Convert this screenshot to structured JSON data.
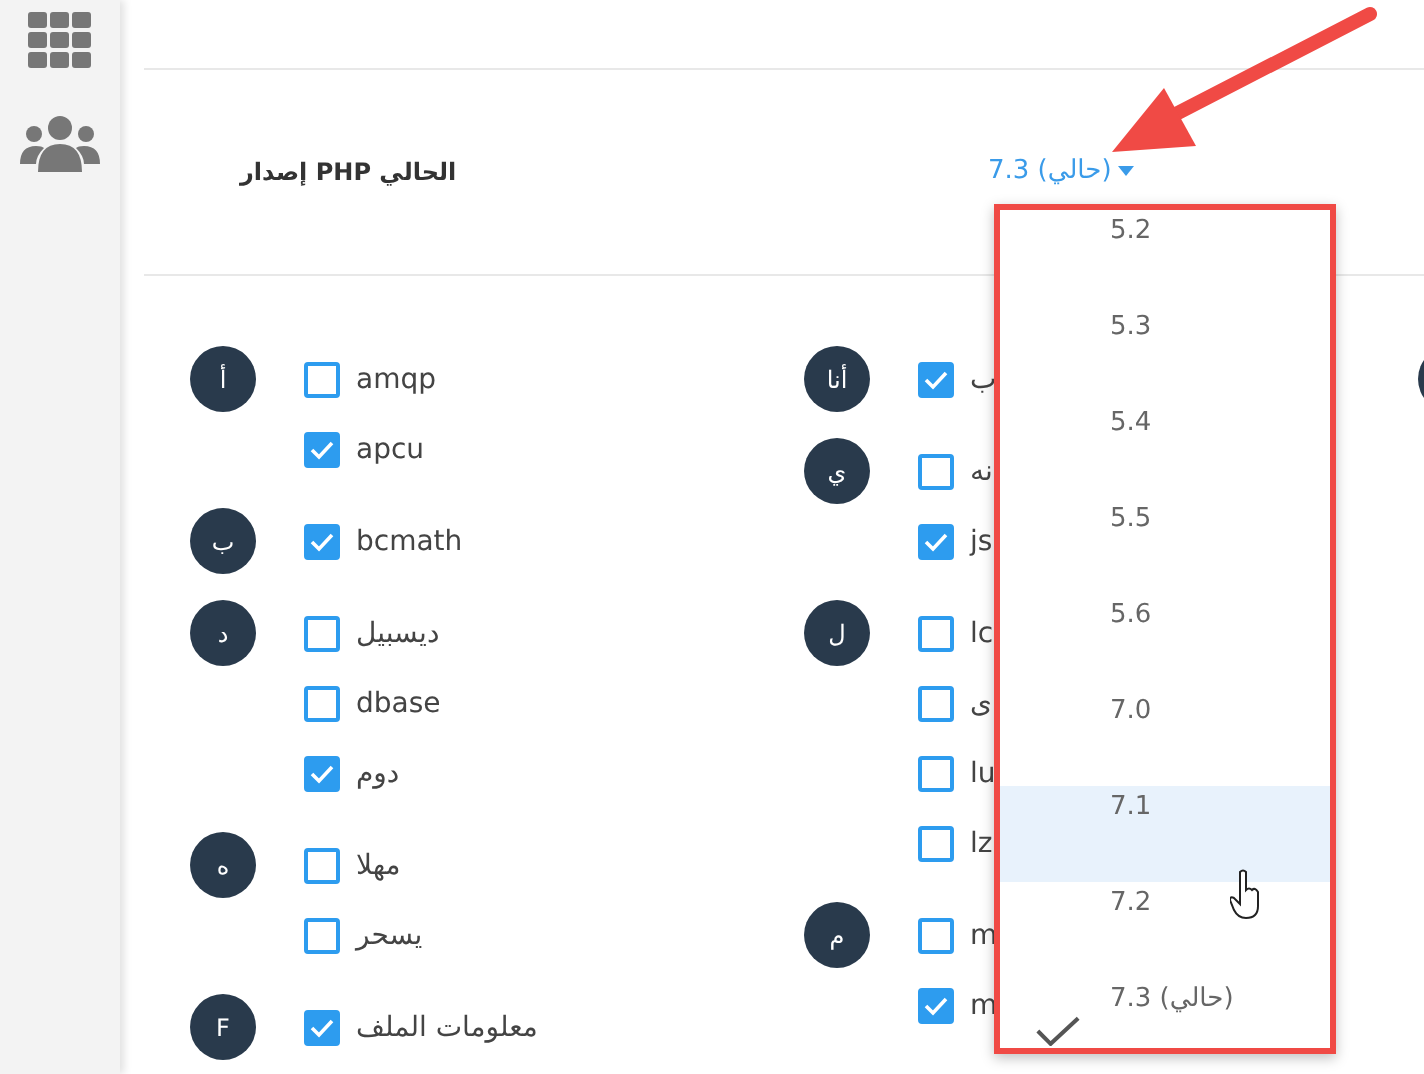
{
  "version_setting": {
    "label": "إصدار PHP الحالي",
    "current": "7.3 (حالي)"
  },
  "version_menu": [
    {
      "label": "5.2",
      "selected": false,
      "hovered": false
    },
    {
      "label": "5.3",
      "selected": false,
      "hovered": false
    },
    {
      "label": "5.4",
      "selected": false,
      "hovered": false
    },
    {
      "label": "5.5",
      "selected": false,
      "hovered": false
    },
    {
      "label": "5.6",
      "selected": false,
      "hovered": false
    },
    {
      "label": "7.0",
      "selected": false,
      "hovered": false
    },
    {
      "label": "7.1",
      "selected": false,
      "hovered": true
    },
    {
      "label": "7.2",
      "selected": false,
      "hovered": false
    },
    {
      "label": "7.3 (حالي)",
      "selected": true,
      "hovered": false
    }
  ],
  "extension_columns": {
    "left_column": [
      {
        "letter": "أ",
        "items": [
          {
            "label": "amqp",
            "checked": false
          },
          {
            "label": "apcu",
            "checked": true
          }
        ]
      },
      {
        "letter": "ب",
        "items": [
          {
            "label": "bcmath",
            "checked": true
          }
        ]
      },
      {
        "letter": "د",
        "items": [
          {
            "label": "ديسبيل",
            "checked": false
          },
          {
            "label": "dbase",
            "checked": false
          },
          {
            "label": "دوم",
            "checked": true
          }
        ]
      },
      {
        "letter": "ه",
        "items": [
          {
            "label": "مهلا",
            "checked": false
          },
          {
            "label": "يسحر",
            "checked": false
          }
        ]
      },
      {
        "letter": "F",
        "items": [
          {
            "label": "معلومات الملف",
            "checked": true
          }
        ]
      }
    ],
    "right_column": [
      {
        "letter": "أنا",
        "items": [
          {
            "label": "ب",
            "checked": true
          }
        ]
      },
      {
        "letter": "ي",
        "items": [
          {
            "label": "نه",
            "checked": false
          },
          {
            "label": "js",
            "checked": true
          }
        ]
      },
      {
        "letter": "ل",
        "items": [
          {
            "label": "lc",
            "checked": false
          },
          {
            "label": "ى",
            "checked": false
          },
          {
            "label": "lu",
            "checked": false
          },
          {
            "label": "lz",
            "checked": false
          }
        ]
      },
      {
        "letter": "م",
        "items": [
          {
            "label": "m",
            "checked": false
          },
          {
            "label": "m",
            "checked": true
          }
        ]
      }
    ]
  }
}
